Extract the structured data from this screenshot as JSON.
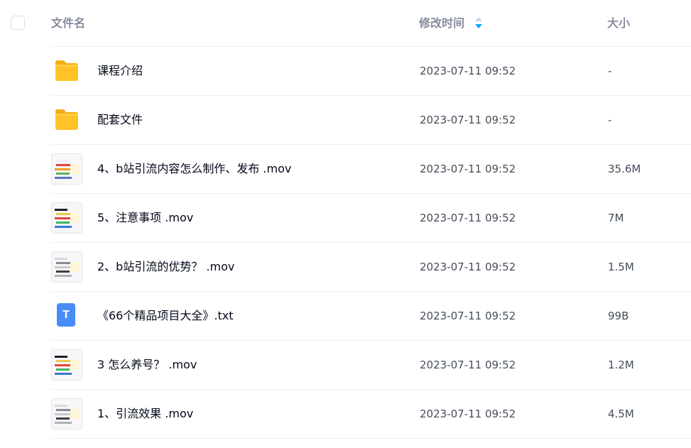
{
  "header": {
    "name_label": "文件名",
    "time_label": "修改时间",
    "size_label": "大小"
  },
  "colors": {
    "header_text": "#878c9c",
    "name_text": "#03081a",
    "meta_text": "#454d5a",
    "divider": "#eef0f4",
    "sort_active": "#06a7ff",
    "sort_inactive": "#c4d8f0",
    "folder": "#ffc329",
    "txt_icon": "#4a8cf7"
  },
  "files": [
    {
      "icon": "folder-icon",
      "name": "课程介绍",
      "time": "2023-07-11 09:52",
      "size": "-"
    },
    {
      "icon": "folder-icon",
      "name": "配套文件",
      "time": "2023-07-11 09:52",
      "size": "-"
    },
    {
      "icon": "video-thumbnail-icon",
      "name": "4、b站引流内容怎么制作、发布 .mov",
      "time": "2023-07-11 09:52",
      "size": "35.6M"
    },
    {
      "icon": "video-thumbnail-icon",
      "name": "5、注意事项 .mov",
      "time": "2023-07-11 09:52",
      "size": "7M"
    },
    {
      "icon": "video-thumbnail-icon",
      "name": "2、b站引流的优势？ .mov",
      "time": "2023-07-11 09:52",
      "size": "1.5M"
    },
    {
      "icon": "text-file-icon",
      "icon_letter": "T",
      "name": "《66个精品项目大全》.txt",
      "time": "2023-07-11 09:52",
      "size": "99B"
    },
    {
      "icon": "video-thumbnail-icon",
      "name": "3 怎么养号？ .mov",
      "time": "2023-07-11 09:52",
      "size": "1.2M"
    },
    {
      "icon": "video-thumbnail-icon",
      "name": "1、引流效果 .mov",
      "time": "2023-07-11 09:52",
      "size": "4.5M"
    }
  ]
}
